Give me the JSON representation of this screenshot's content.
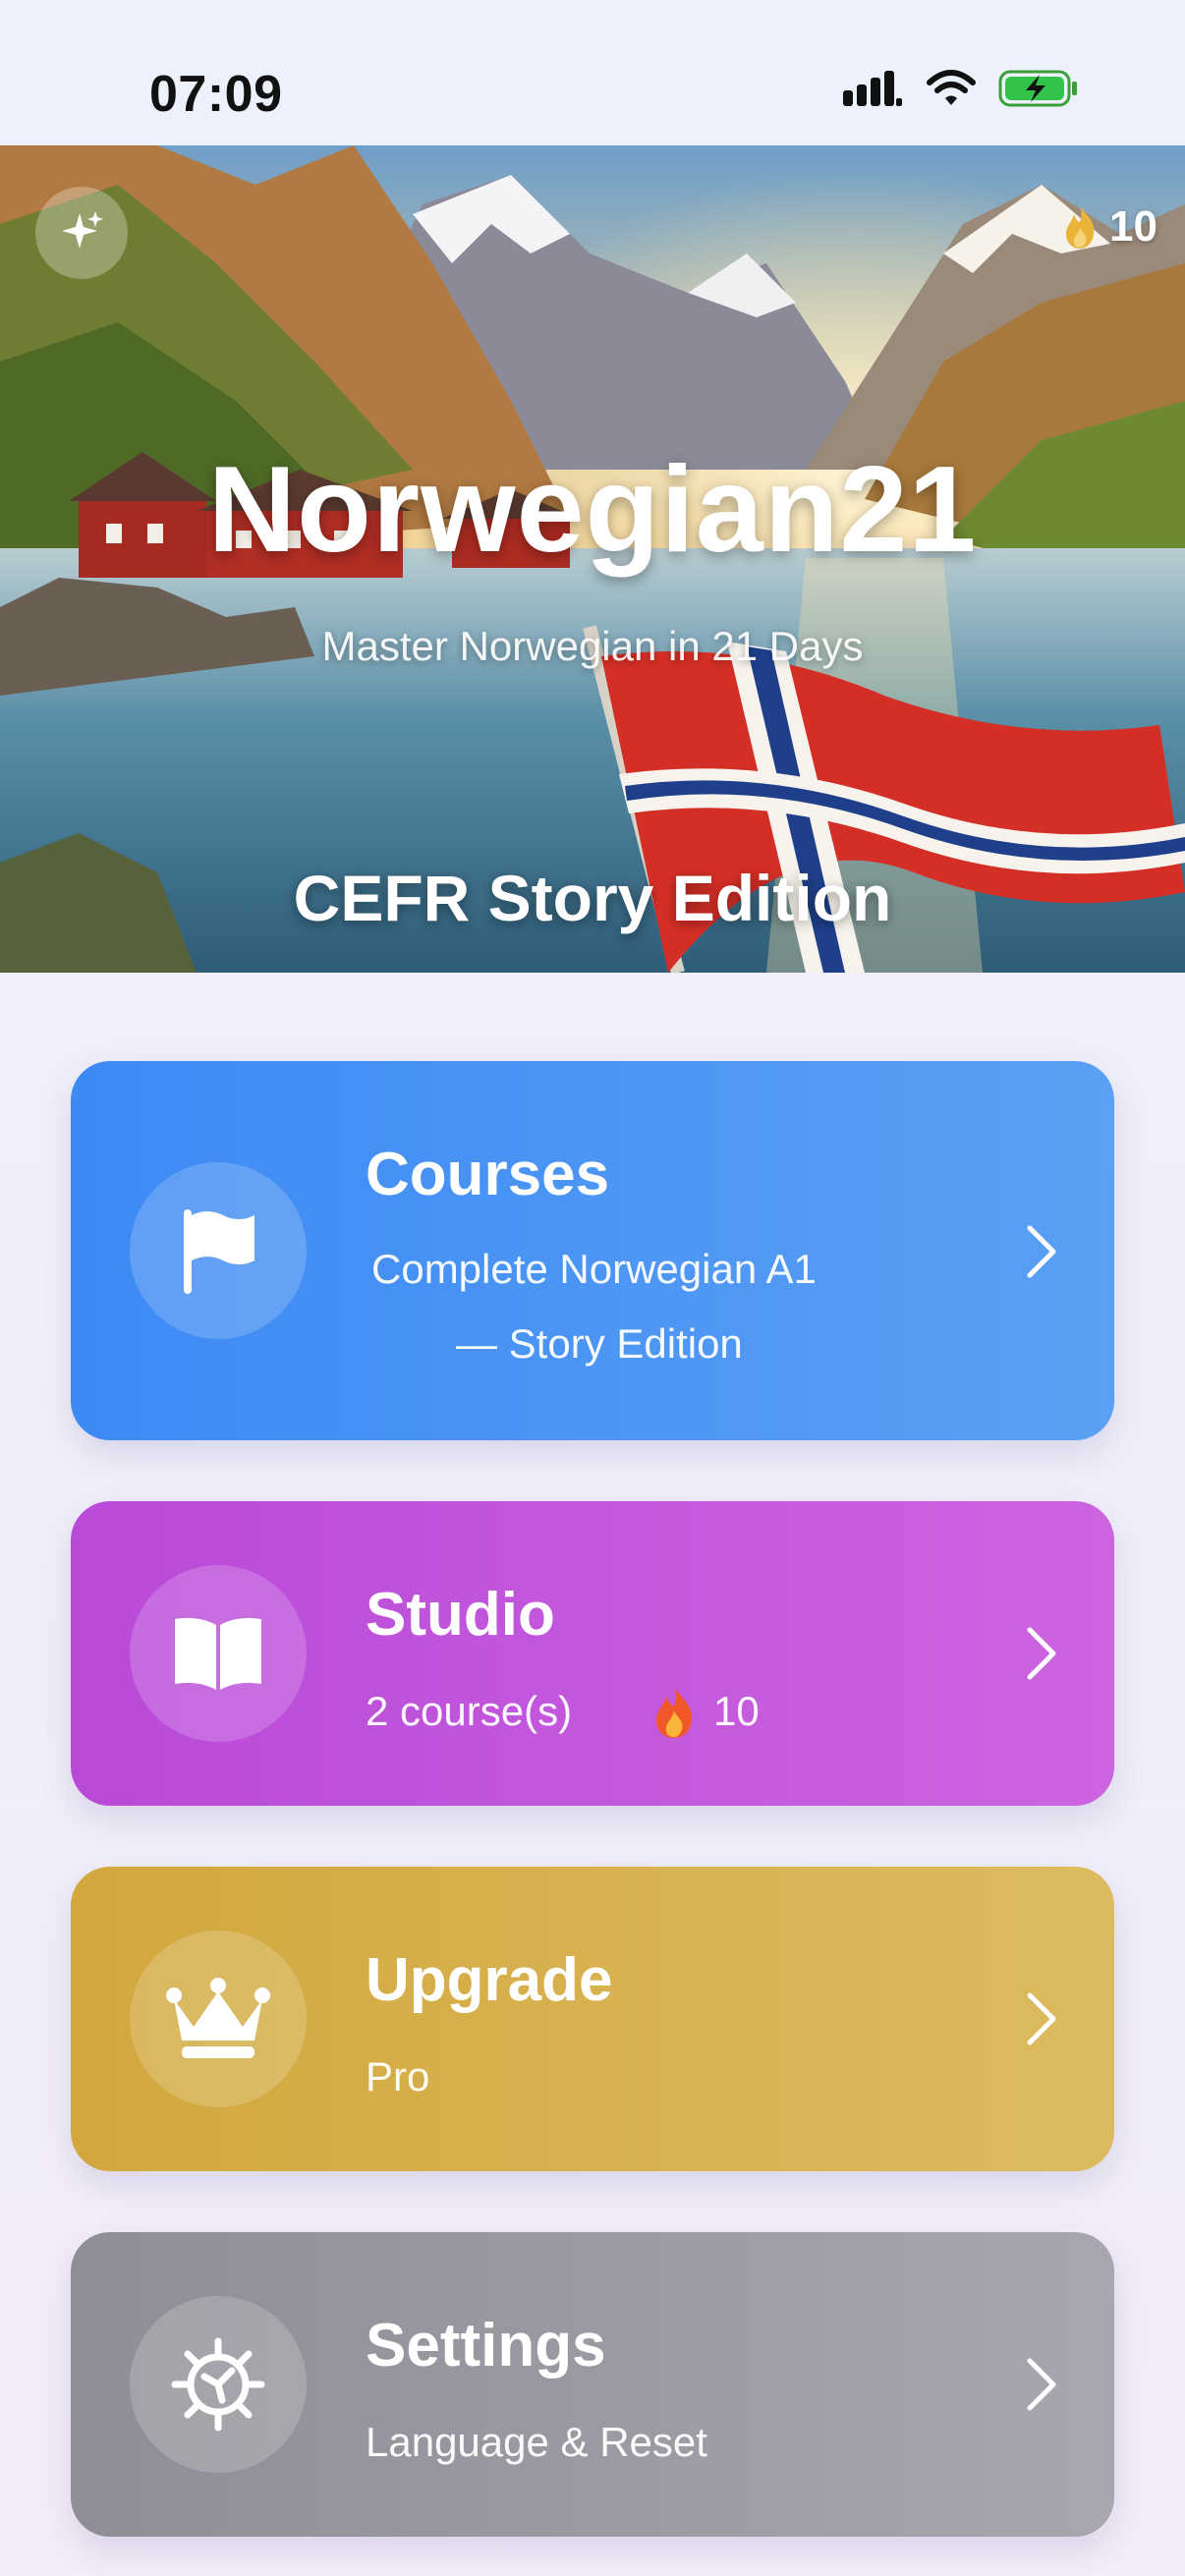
{
  "status_bar": {
    "time": "07:09"
  },
  "hero": {
    "title": "Norwegian21",
    "subtitle": "Master Norwegian in 21 Days",
    "edition": "CEFR Story Edition",
    "streak_count": "10",
    "icons": [
      "sparkles-icon",
      "flame-icon"
    ]
  },
  "cards": {
    "courses": {
      "title": "Courses",
      "subtitle_line1": "Complete Norwegian A1",
      "subtitle_line2": "— Story Edition",
      "icon": "flag-icon",
      "color": "#3d8af4"
    },
    "studio": {
      "title": "Studio",
      "subtitle": "2 course(s)",
      "streak": "10",
      "icon": "book-icon",
      "color": "#b94ad8"
    },
    "upgrade": {
      "title": "Upgrade",
      "subtitle": "Pro",
      "icon": "crown-icon",
      "color": "#d2a83d"
    },
    "settings": {
      "title": "Settings",
      "subtitle": "Language & Reset",
      "icon": "gear-icon",
      "color": "#8e8e96"
    }
  }
}
